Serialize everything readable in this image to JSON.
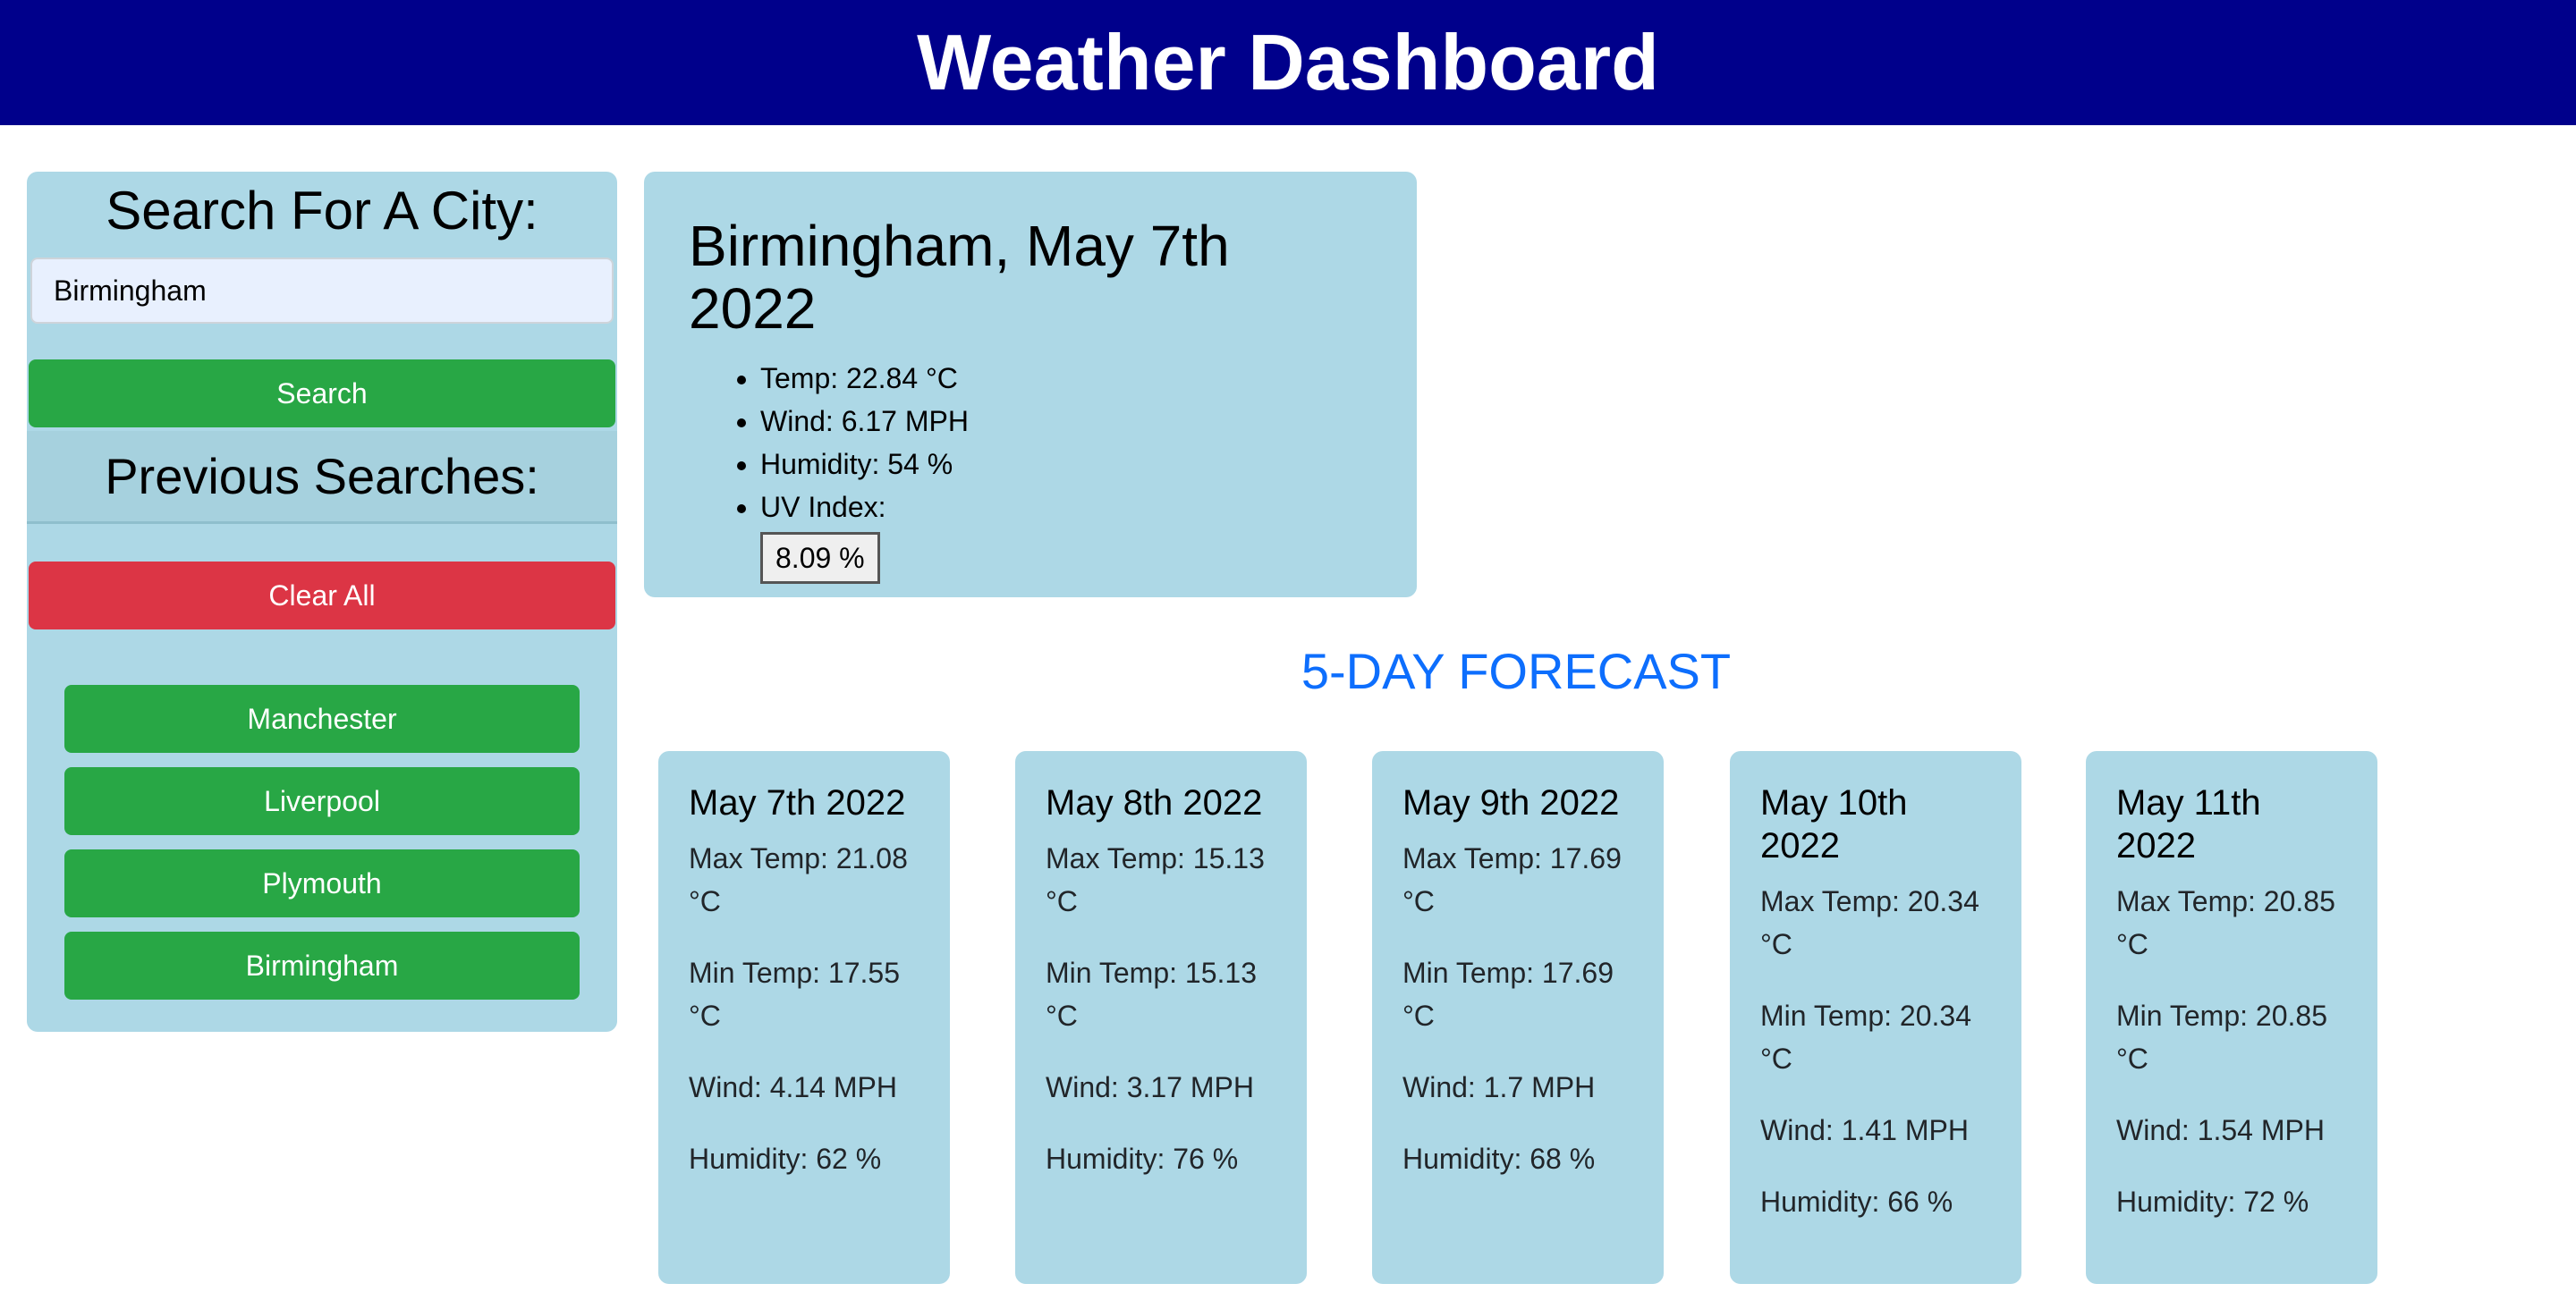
{
  "header": {
    "title": "Weather Dashboard"
  },
  "sidebar": {
    "title": "Search For A City:",
    "search_value": "Birmingham",
    "search_button": "Search",
    "previous_title": "Previous Searches:",
    "clear_button": "Clear All",
    "history": [
      "Manchester",
      "Liverpool",
      "Plymouth",
      "Birmingham"
    ]
  },
  "current": {
    "title": "Birmingham, May 7th 2022",
    "temp": "Temp: 22.84 °C",
    "wind": "Wind: 6.17 MPH",
    "humidity": "Humidity: 54 %",
    "uv_label": "UV Index:",
    "uv_value": "8.09 %"
  },
  "forecast": {
    "title": "5-DAY FORECAST",
    "days": [
      {
        "date": "May 7th 2022",
        "max": "Max Temp: 21.08 °C",
        "min": "Min Temp: 17.55 °C",
        "wind": "Wind: 4.14 MPH",
        "humidity": "Humidity: 62 %"
      },
      {
        "date": "May 8th 2022",
        "max": "Max Temp: 15.13 °C",
        "min": "Min Temp: 15.13 °C",
        "wind": "Wind: 3.17 MPH",
        "humidity": "Humidity: 76 %"
      },
      {
        "date": "May 9th 2022",
        "max": "Max Temp: 17.69 °C",
        "min": "Min Temp: 17.69 °C",
        "wind": "Wind: 1.7 MPH",
        "humidity": "Humidity: 68 %"
      },
      {
        "date": "May 10th 2022",
        "max": "Max Temp: 20.34 °C",
        "min": "Min Temp: 20.34 °C",
        "wind": "Wind: 1.41 MPH",
        "humidity": "Humidity: 66 %"
      },
      {
        "date": "May 11th 2022",
        "max": "Max Temp: 20.85 °C",
        "min": "Min Temp: 20.85 °C",
        "wind": "Wind: 1.54 MPH",
        "humidity": "Humidity: 72 %"
      }
    ]
  },
  "colors": {
    "header_bg": "#00008b",
    "panel_bg": "#add8e6",
    "green": "#28a745",
    "red": "#dc3545",
    "forecast_title": "#0d6efd"
  }
}
